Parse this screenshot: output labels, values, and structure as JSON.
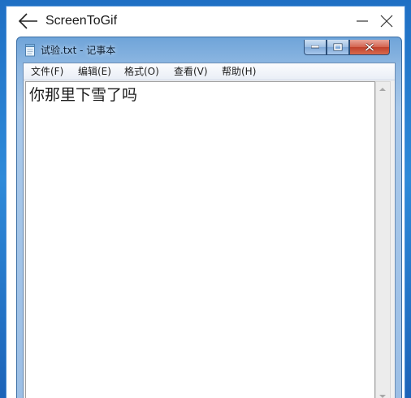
{
  "screentogif": {
    "title": "ScreenToGif",
    "back_icon": "back-arrow-icon",
    "minimize_icon": "minimize-icon",
    "close_icon": "close-icon"
  },
  "notepad": {
    "title": "试验.txt - 记事本",
    "icon": "notepad-icon",
    "menu": [
      {
        "label": "文件(F)"
      },
      {
        "label": "编辑(E)"
      },
      {
        "label": "格式(O)"
      },
      {
        "label": "查看(V)"
      },
      {
        "label": "帮助(H)"
      }
    ],
    "content": "你那里下雪了吗",
    "colors": {
      "close_button": "#c0412c",
      "frame": "#9cbfe6"
    }
  }
}
